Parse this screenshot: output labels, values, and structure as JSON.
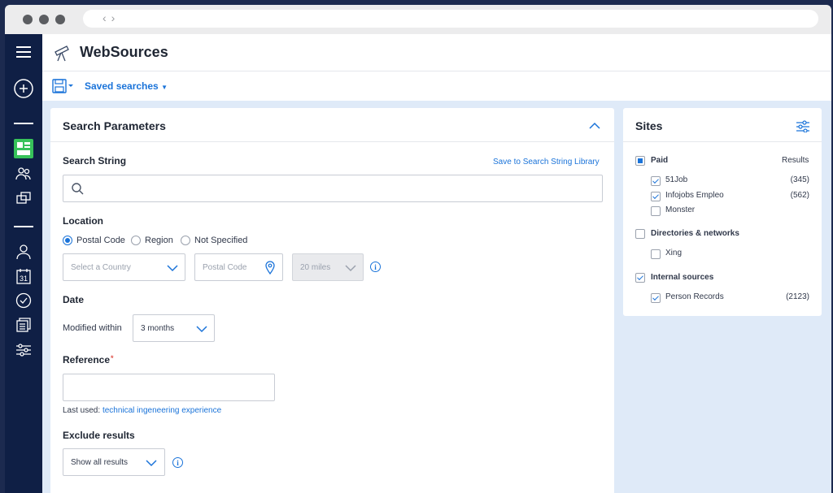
{
  "app": {
    "title": "WebSources"
  },
  "toolbar": {
    "saved_searches": "Saved searches"
  },
  "search_panel": {
    "title": "Search Parameters",
    "search_string_label": "Search String",
    "save_to_library": "Save to Search String Library",
    "search_placeholder": "",
    "location": {
      "label": "Location",
      "options": [
        "Postal Code",
        "Region",
        "Not Specified"
      ],
      "selected": "Postal Code",
      "country_placeholder": "Select a Country",
      "postal_placeholder": "Postal Code",
      "radius_value": "20 miles"
    },
    "date": {
      "label": "Date",
      "modified_label": "Modified within",
      "modified_value": "3 months"
    },
    "reference": {
      "label": "Reference",
      "required_mark": "*",
      "value": "",
      "last_used_label": "Last used:",
      "last_used_value": "technical ingeneering experience"
    },
    "exclude": {
      "label": "Exclude results",
      "value": "Show all results"
    }
  },
  "sites_panel": {
    "title": "Sites",
    "results_header": "Results",
    "groups": [
      {
        "name": "Paid",
        "state": "partial",
        "items": [
          {
            "name": "51Job",
            "checked": true,
            "count": "(345)"
          },
          {
            "name": "Infojobs Empleo",
            "checked": true,
            "count": "(562)"
          },
          {
            "name": "Monster",
            "checked": false,
            "count": ""
          }
        ]
      },
      {
        "name": "Directories & networks",
        "state": "unchecked",
        "items": [
          {
            "name": "Xing",
            "checked": false,
            "count": ""
          }
        ]
      },
      {
        "name": "Internal sources",
        "state": "checked",
        "items": [
          {
            "name": "Person Records",
            "checked": true,
            "count": "(2123)"
          }
        ]
      }
    ]
  },
  "icons": {
    "sidebar": [
      "menu-icon",
      "add-circle-icon",
      "dashboard-icon",
      "people-icon",
      "folders-icon",
      "person-icon",
      "calendar-icon",
      "check-circle-icon",
      "documents-icon",
      "sliders-icon"
    ],
    "calendar_day": "31"
  },
  "colors": {
    "accent": "#1a73d9",
    "sidebar": "#0f1f45",
    "content_bg": "#dfeaf8",
    "active_icon": "#37c25a"
  }
}
